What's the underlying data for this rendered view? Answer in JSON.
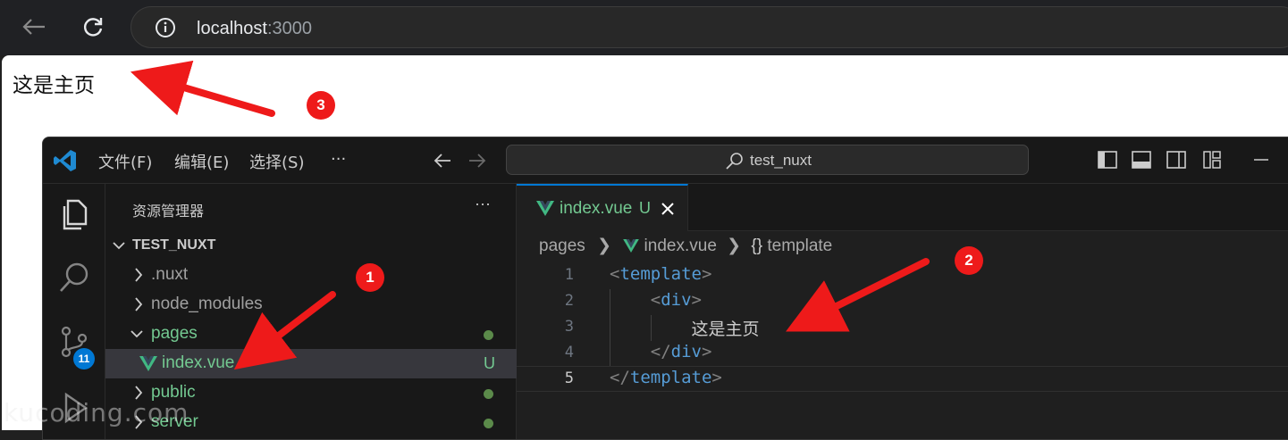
{
  "browser": {
    "back_icon": "arrow-left-icon",
    "reload_icon": "reload-icon",
    "info_icon": "info-circle-icon",
    "url_host": "localhost",
    "url_port": ":3000"
  },
  "page": {
    "content_text": "这是主页"
  },
  "vscode": {
    "menus": [
      "文件(F)",
      "编辑(E)",
      "选择(S)",
      "···"
    ],
    "command_center": "test_nuxt",
    "activity_badge": "11",
    "sidebar": {
      "title": "资源管理器",
      "more": "···",
      "root": "TEST_NUXT",
      "items": [
        {
          "label": ".nuxt",
          "type": "folder",
          "expanded": false,
          "status": ""
        },
        {
          "label": "node_modules",
          "type": "folder",
          "expanded": false,
          "status": ""
        },
        {
          "label": "pages",
          "type": "folder",
          "expanded": true,
          "status": "dot"
        },
        {
          "label": "index.vue",
          "type": "file",
          "selected": true,
          "status": "U"
        },
        {
          "label": "public",
          "type": "folder",
          "expanded": false,
          "status": "dot"
        },
        {
          "label": "server",
          "type": "folder",
          "expanded": false,
          "status": "dot"
        }
      ]
    },
    "tab": {
      "label": "index.vue",
      "status": "U"
    },
    "breadcrumb": {
      "folder": "pages",
      "file": "index.vue",
      "symbol": "template"
    },
    "code_lines": [
      {
        "number": "1",
        "open": "<",
        "name": "template",
        "close": ">",
        "indent": ""
      },
      {
        "number": "2",
        "open": "<",
        "name": "div",
        "close": ">",
        "indent": "    "
      },
      {
        "number": "3",
        "text": "这是主页",
        "indent": "        "
      },
      {
        "number": "4",
        "open": "</",
        "name": "div",
        "close": ">",
        "indent": "    "
      },
      {
        "number": "5",
        "open": "</",
        "name": "template",
        "close": ">",
        "indent": ""
      }
    ]
  },
  "annotations": {
    "markers": [
      "1",
      "2",
      "3"
    ],
    "color": "#ee1a1a"
  },
  "watermark": "kucoding.com"
}
